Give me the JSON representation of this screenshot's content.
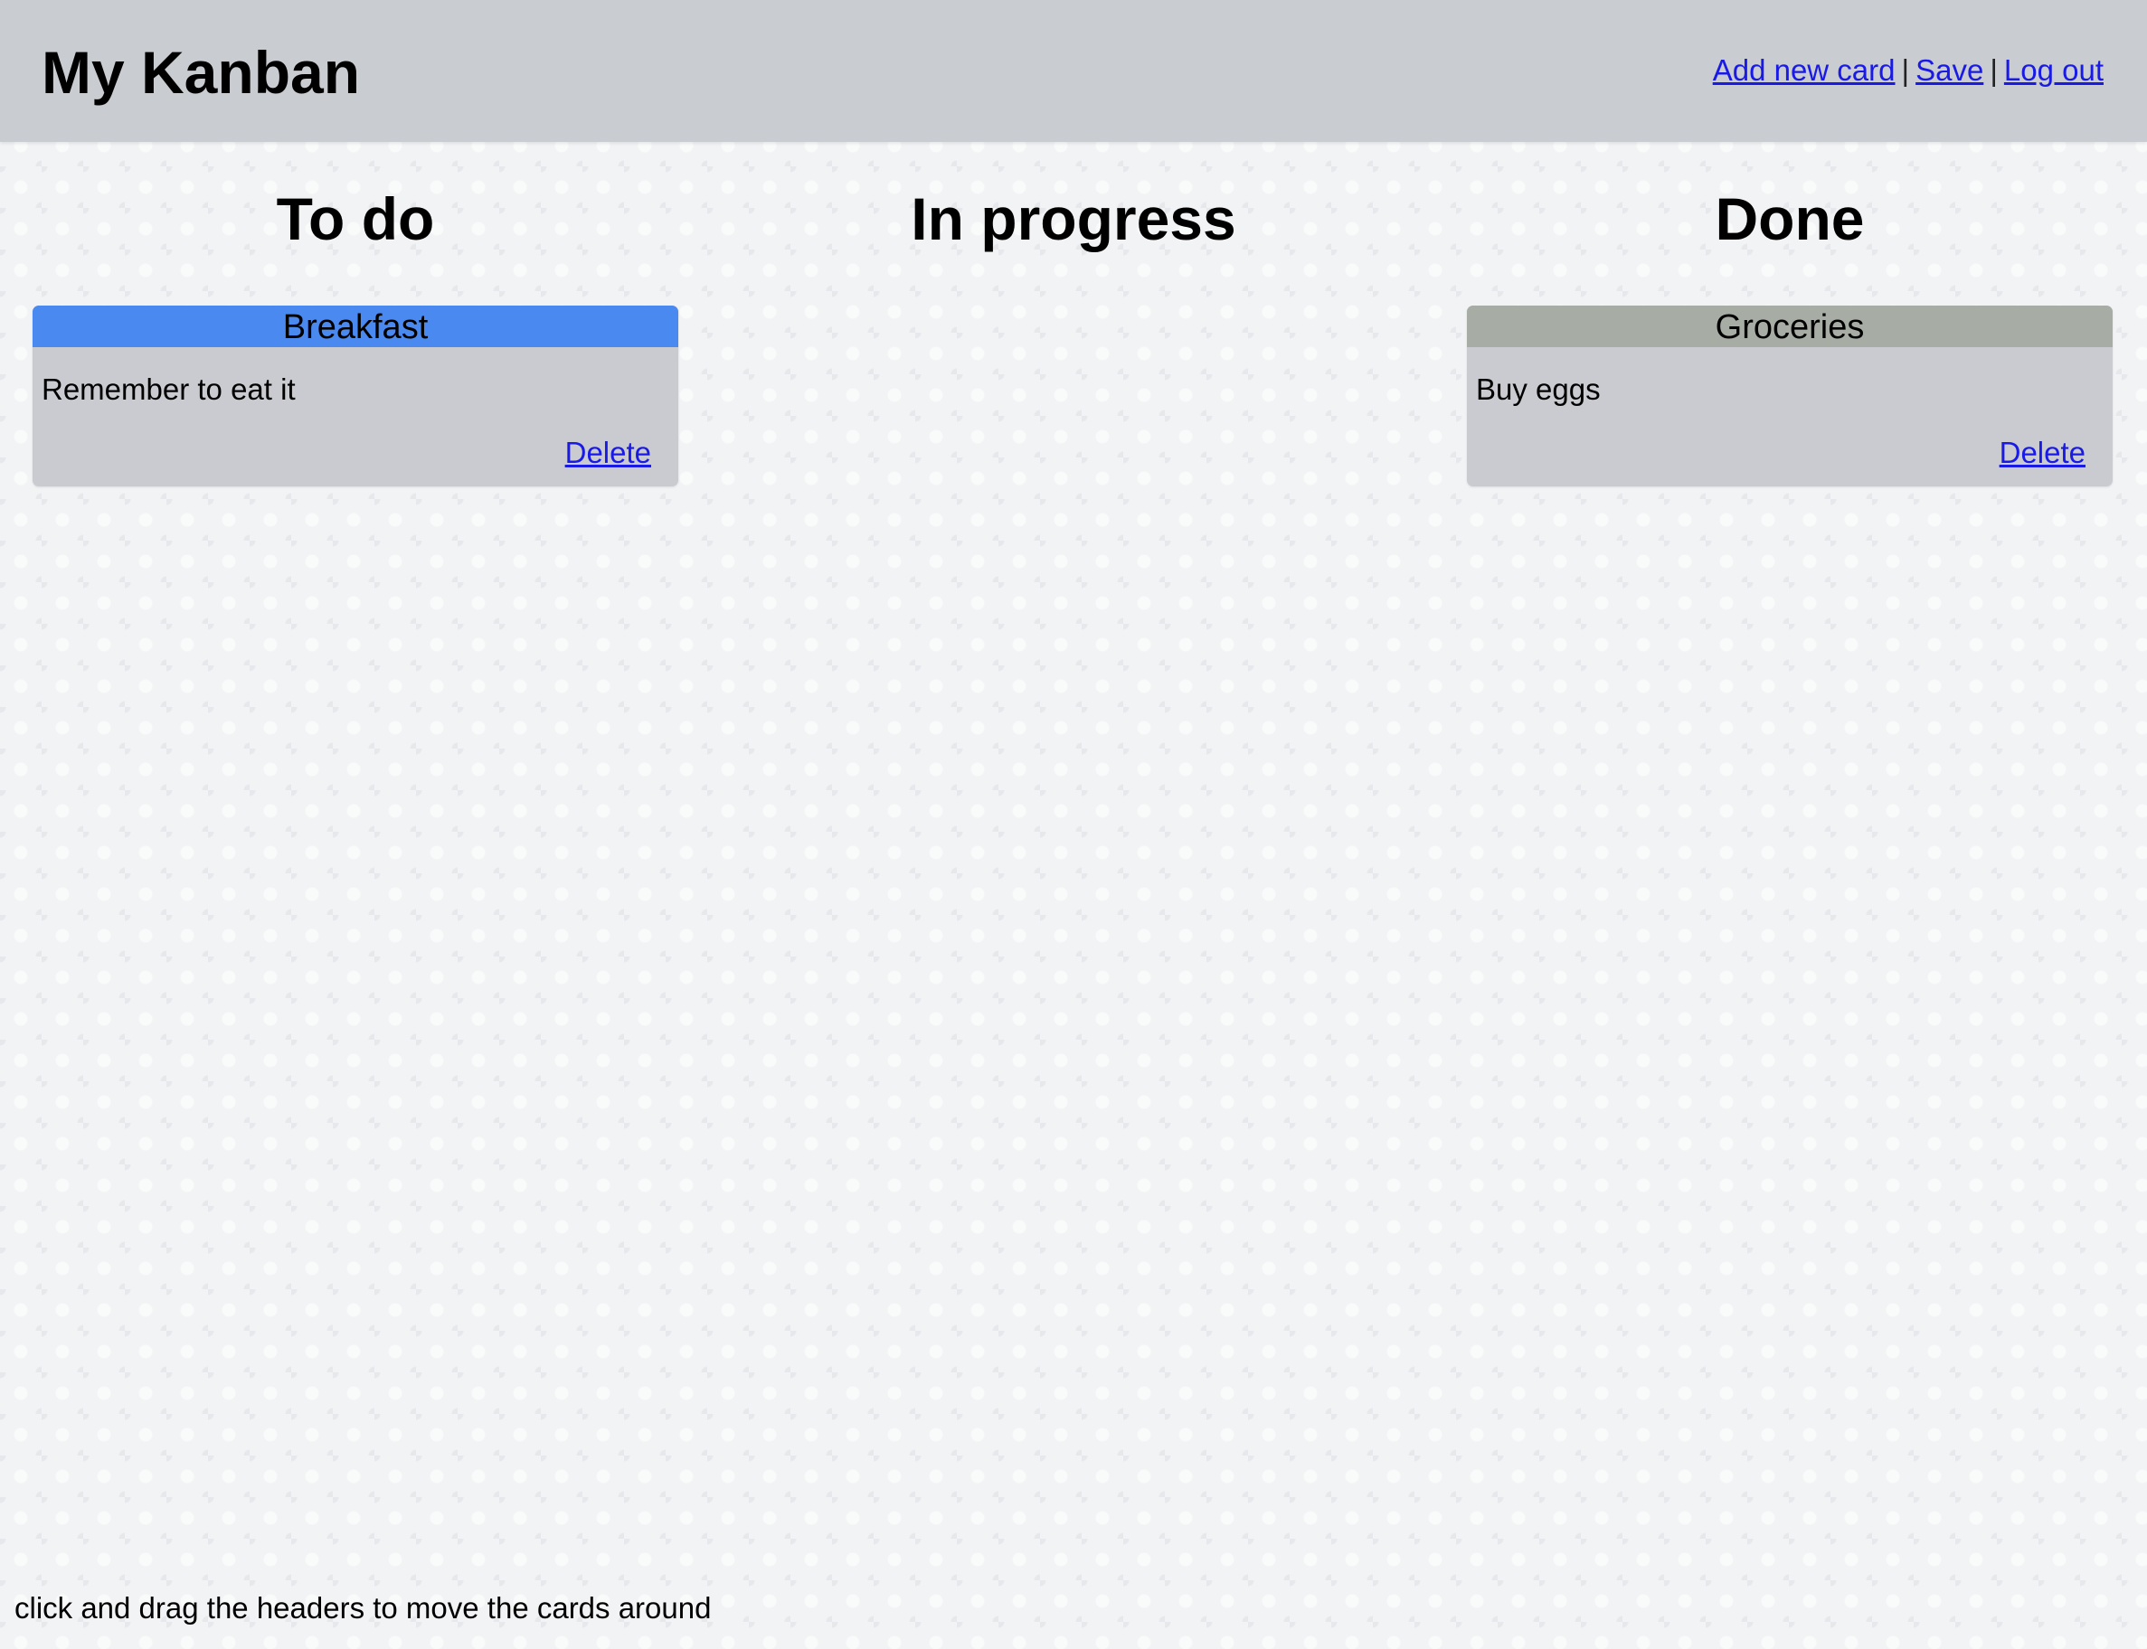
{
  "app": {
    "title": "My Kanban"
  },
  "toolbar": {
    "add_label": "Add new card",
    "separator": "|",
    "save_label": "Save",
    "logout_label": "Log out"
  },
  "columns": [
    {
      "title": "To do",
      "cards": [
        {
          "title": "Breakfast",
          "text": "Remember to eat it",
          "delete_label": "Delete",
          "header_color": "#4a89f0"
        }
      ]
    },
    {
      "title": "In progress",
      "cards": []
    },
    {
      "title": "Done",
      "cards": [
        {
          "title": "Groceries",
          "text": "Buy eggs",
          "delete_label": "Delete",
          "header_color": "#a7ada4"
        }
      ]
    }
  ],
  "footer": {
    "hint": "click and drag the headers to move the cards around"
  },
  "colors": {
    "topbar": "#c9ccd1",
    "page_background": "#f2f3f5",
    "card_body": "#c9cbd0",
    "link": "#1a1ae6"
  }
}
